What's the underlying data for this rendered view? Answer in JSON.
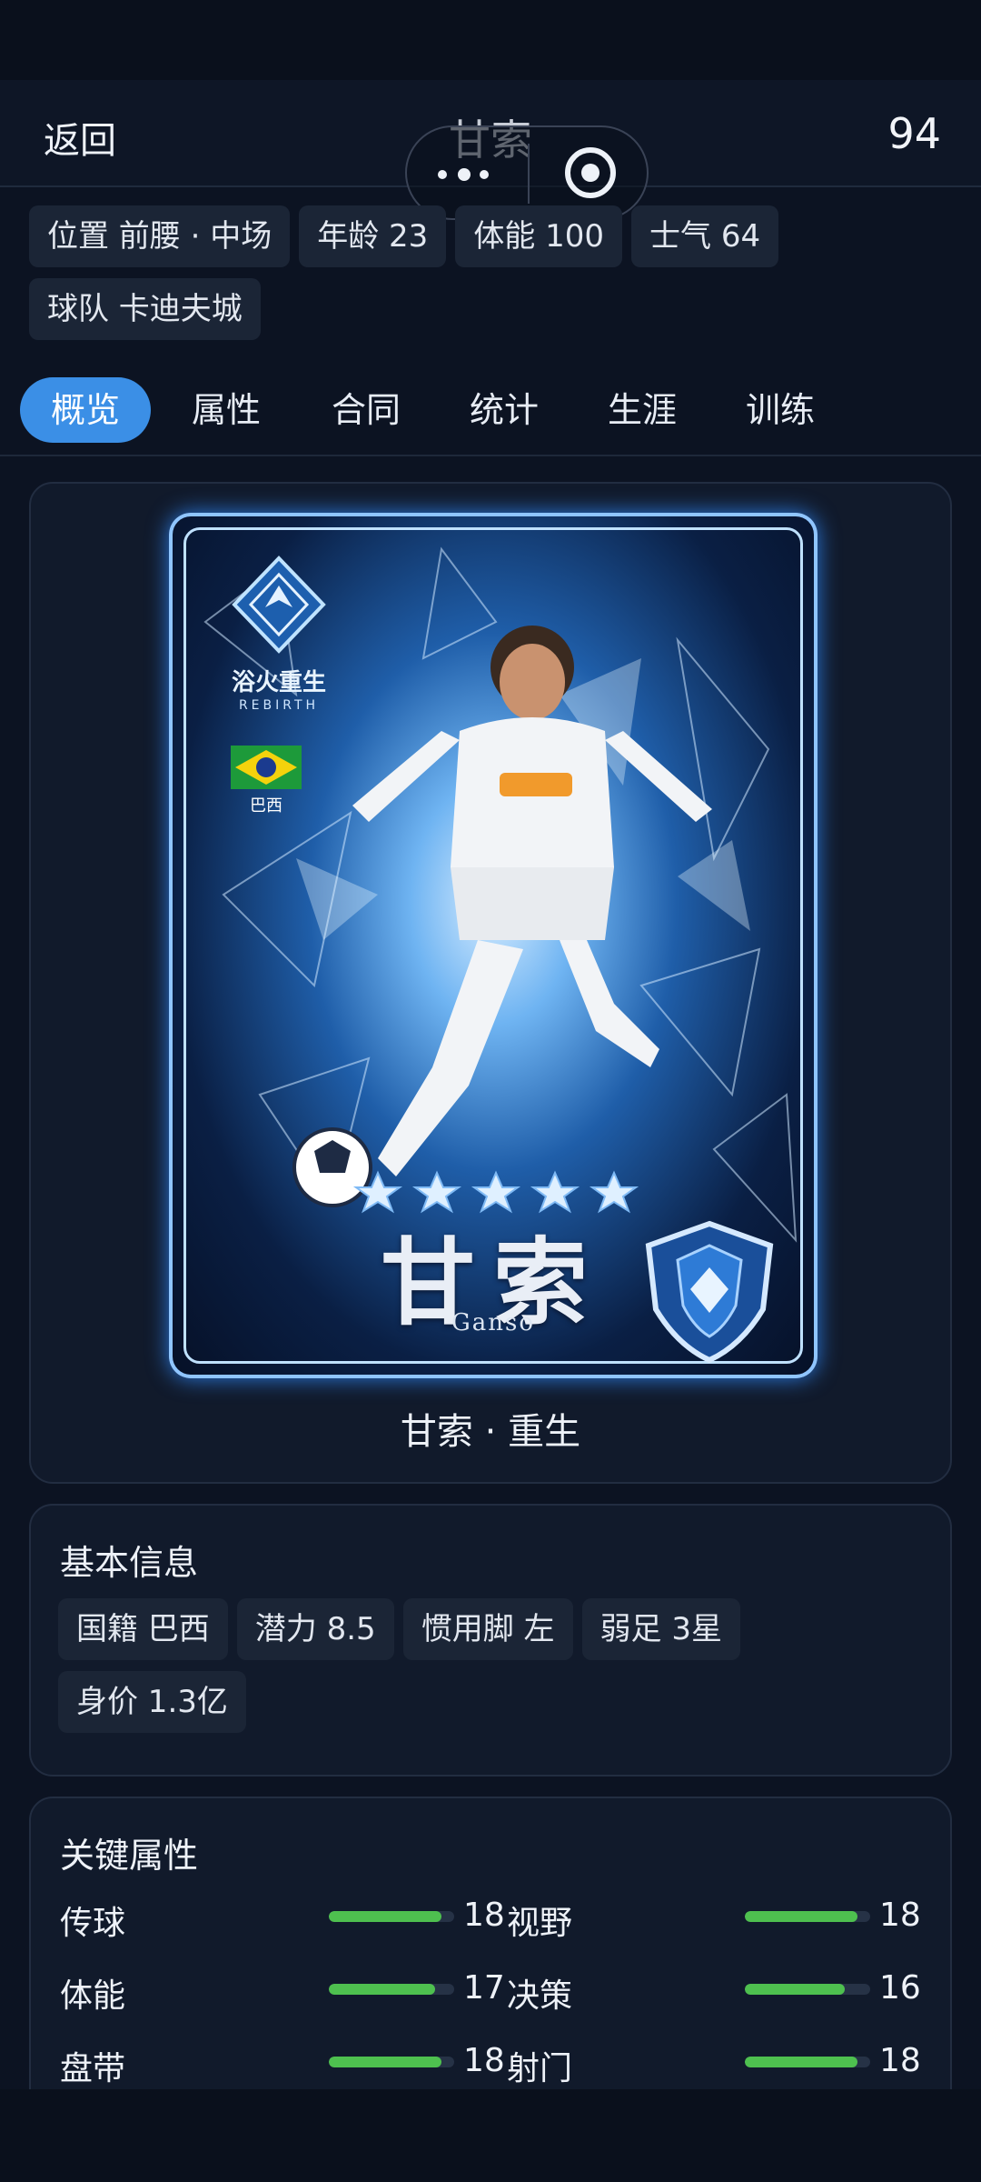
{
  "nav": {
    "back_label": "返回",
    "title": "甘索",
    "rating": "94"
  },
  "capsule": {
    "more_icon": "more-dots-icon",
    "close_icon": "target-close-icon"
  },
  "player_chips": [
    {
      "label": "位置 前腰 · 中场"
    },
    {
      "label": "年龄 23"
    },
    {
      "label": "体能 100"
    },
    {
      "label": "士气 64"
    },
    {
      "label": "球队 卡迪夫城"
    }
  ],
  "tabs": [
    {
      "label": "概览",
      "active": true
    },
    {
      "label": "属性",
      "active": false
    },
    {
      "label": "合同",
      "active": false
    },
    {
      "label": "统计",
      "active": false
    },
    {
      "label": "生涯",
      "active": false
    },
    {
      "label": "训练",
      "active": false
    }
  ],
  "card": {
    "brand": "浴火重生",
    "brand_sub": "REBIRTH",
    "flag_label": "巴西",
    "name_cn": "甘索",
    "name_en": "Ganso",
    "stars": 5,
    "caption": "甘索 · 重生"
  },
  "basic_info": {
    "title": "基本信息",
    "chips": [
      {
        "label": "国籍 巴西"
      },
      {
        "label": "潜力 8.5"
      },
      {
        "label": "惯用脚 左"
      },
      {
        "label": "弱足 3星"
      },
      {
        "label": "身价 1.3亿"
      }
    ]
  },
  "key_attributes": {
    "title": "关键属性",
    "max": 20,
    "rows": [
      {
        "left_label": "传球",
        "left_value": 18,
        "right_label": "视野",
        "right_value": 18
      },
      {
        "left_label": "体能",
        "left_value": 17,
        "right_label": "决策",
        "right_value": 16
      },
      {
        "left_label": "盘带",
        "left_value": 18,
        "right_label": "射门",
        "right_value": 18
      }
    ]
  },
  "colors": {
    "accent": "#3b8fe6",
    "bar_fill": "#4ec04f",
    "background": "#0c1322",
    "card": "#111a2b"
  }
}
